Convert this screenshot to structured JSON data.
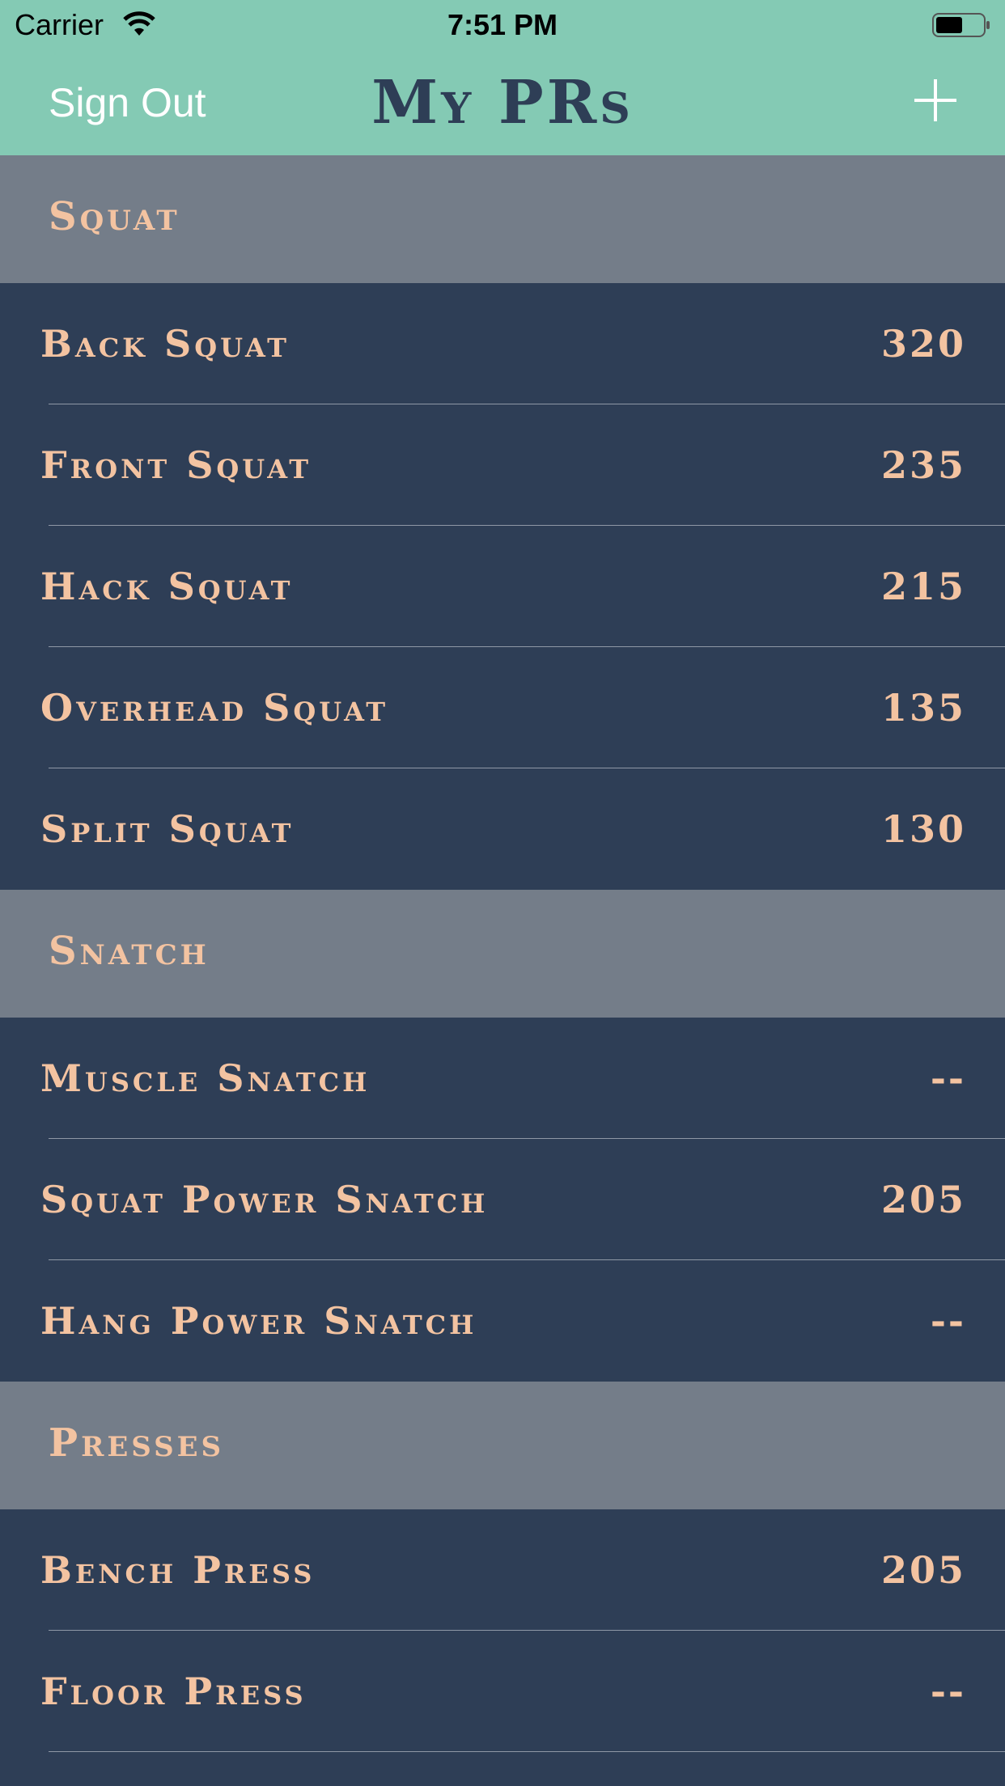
{
  "status_bar": {
    "carrier": "Carrier",
    "time": "7:51 PM",
    "wifi_icon": "wifi-icon",
    "battery_icon": "battery-icon"
  },
  "nav": {
    "left_button": "Sign Out",
    "title": "My PRs",
    "right_icon": "plus-icon"
  },
  "colors": {
    "nav_bg": "#84cab4",
    "title_color": "#2e3e56",
    "row_bg": "#2e3e56",
    "header_bg": "#747d89",
    "accent_text": "#f3c3a1"
  },
  "sections": [
    {
      "title": "Squat",
      "rows": [
        {
          "name": "Back Squat",
          "value": "320"
        },
        {
          "name": "Front Squat",
          "value": "235"
        },
        {
          "name": "Hack Squat",
          "value": "215"
        },
        {
          "name": "Overhead Squat",
          "value": "135"
        },
        {
          "name": "Split Squat",
          "value": "130"
        }
      ]
    },
    {
      "title": "Snatch",
      "rows": [
        {
          "name": "Muscle Snatch",
          "value": "--"
        },
        {
          "name": "Squat Power Snatch",
          "value": "205"
        },
        {
          "name": "Hang Power Snatch",
          "value": "--"
        }
      ]
    },
    {
      "title": "Presses",
      "rows": [
        {
          "name": "Bench Press",
          "value": "205"
        },
        {
          "name": "Floor Press",
          "value": "--"
        }
      ]
    }
  ]
}
